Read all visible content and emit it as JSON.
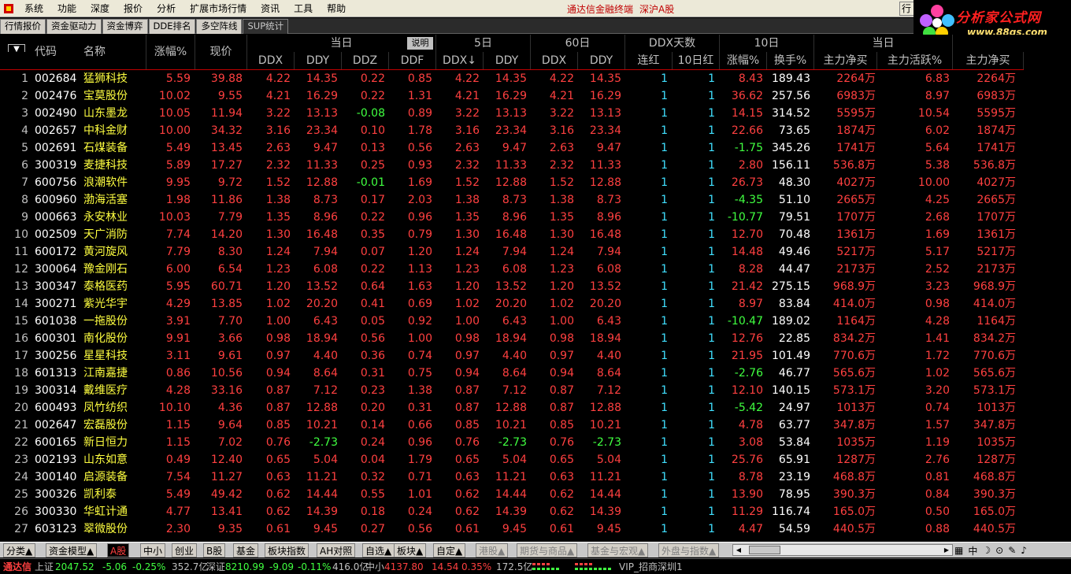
{
  "menu": {
    "items": [
      "系统",
      "功能",
      "深度",
      "报价",
      "分析",
      "扩展市场行情",
      "资讯",
      "工具",
      "帮助"
    ],
    "title_left": "通达信金融终端",
    "title_right": "深沪A股",
    "window_tab": "行"
  },
  "brand": {
    "title": "分析家公式网",
    "url": "www.88gs.com"
  },
  "tabs": [
    "行情报价",
    "资金驱动力",
    "资金博弈",
    "DDE排名",
    "多空阵线",
    "SUP统计"
  ],
  "header": {
    "top": {
      "today": "当日",
      "explain": "说明",
      "d5": "5日",
      "d60": "60日",
      "ddx_days": "DDX天数",
      "d10": "10日",
      "today2": "当日"
    },
    "cols": [
      "代码",
      "名称",
      "涨幅%",
      "现价",
      "DDX",
      "DDY",
      "DDZ",
      "DDF",
      "DDX↓",
      "DDY",
      "DDX",
      "DDY",
      "连红",
      "10日红",
      "涨幅%",
      "换手%",
      "主力净买",
      "主力活跃%",
      "主力净买"
    ]
  },
  "rows": [
    [
      "1",
      "002684",
      "猛狮科技",
      "5.59",
      "39.88",
      "4.22",
      "14.35",
      "0.22",
      "0.85",
      "4.22",
      "14.35",
      "4.22",
      "14.35",
      "1",
      "1",
      "8.43",
      "189.43",
      "2264万",
      "6.83",
      "2264万"
    ],
    [
      "2",
      "002476",
      "宝莫股份",
      "10.02",
      "9.55",
      "4.21",
      "16.29",
      "0.22",
      "1.31",
      "4.21",
      "16.29",
      "4.21",
      "16.29",
      "1",
      "1",
      "36.62",
      "257.56",
      "6983万",
      "8.97",
      "6983万"
    ],
    [
      "3",
      "002490",
      "山东墨龙",
      "10.05",
      "11.94",
      "3.22",
      "13.13",
      "-0.08",
      "0.89",
      "3.22",
      "13.13",
      "3.22",
      "13.13",
      "1",
      "1",
      "14.15",
      "314.52",
      "5595万",
      "10.54",
      "5595万"
    ],
    [
      "4",
      "002657",
      "中科金财",
      "10.00",
      "34.32",
      "3.16",
      "23.34",
      "0.10",
      "1.78",
      "3.16",
      "23.34",
      "3.16",
      "23.34",
      "1",
      "1",
      "22.66",
      "73.65",
      "1874万",
      "6.02",
      "1874万"
    ],
    [
      "5",
      "002691",
      "石煤装备",
      "5.49",
      "13.45",
      "2.63",
      "9.47",
      "0.13",
      "0.56",
      "2.63",
      "9.47",
      "2.63",
      "9.47",
      "1",
      "1",
      "-1.75",
      "345.26",
      "1741万",
      "5.64",
      "1741万"
    ],
    [
      "6",
      "300319",
      "麦捷科技",
      "5.89",
      "17.27",
      "2.32",
      "11.33",
      "0.25",
      "0.93",
      "2.32",
      "11.33",
      "2.32",
      "11.33",
      "1",
      "1",
      "2.80",
      "156.11",
      "536.8万",
      "5.38",
      "536.8万"
    ],
    [
      "7",
      "600756",
      "浪潮软件",
      "9.95",
      "9.72",
      "1.52",
      "12.88",
      "-0.01",
      "1.69",
      "1.52",
      "12.88",
      "1.52",
      "12.88",
      "1",
      "1",
      "26.73",
      "48.30",
      "4027万",
      "10.00",
      "4027万"
    ],
    [
      "8",
      "600960",
      "渤海活塞",
      "1.98",
      "11.86",
      "1.38",
      "8.73",
      "0.17",
      "2.03",
      "1.38",
      "8.73",
      "1.38",
      "8.73",
      "1",
      "1",
      "-4.35",
      "51.10",
      "2665万",
      "4.25",
      "2665万"
    ],
    [
      "9",
      "000663",
      "永安林业",
      "10.03",
      "7.79",
      "1.35",
      "8.96",
      "0.22",
      "0.96",
      "1.35",
      "8.96",
      "1.35",
      "8.96",
      "1",
      "1",
      "-10.77",
      "79.51",
      "1707万",
      "2.68",
      "1707万"
    ],
    [
      "10",
      "002509",
      "天广消防",
      "7.74",
      "14.20",
      "1.30",
      "16.48",
      "0.35",
      "0.79",
      "1.30",
      "16.48",
      "1.30",
      "16.48",
      "1",
      "1",
      "12.70",
      "70.48",
      "1361万",
      "1.69",
      "1361万"
    ],
    [
      "11",
      "600172",
      "黄河旋风",
      "7.79",
      "8.30",
      "1.24",
      "7.94",
      "0.07",
      "1.20",
      "1.24",
      "7.94",
      "1.24",
      "7.94",
      "1",
      "1",
      "14.48",
      "49.46",
      "5217万",
      "5.17",
      "5217万"
    ],
    [
      "12",
      "300064",
      "豫金刚石",
      "6.00",
      "6.54",
      "1.23",
      "6.08",
      "0.22",
      "1.13",
      "1.23",
      "6.08",
      "1.23",
      "6.08",
      "1",
      "1",
      "8.28",
      "44.47",
      "2173万",
      "2.52",
      "2173万"
    ],
    [
      "13",
      "300347",
      "泰格医药",
      "5.95",
      "60.71",
      "1.20",
      "13.52",
      "0.64",
      "1.63",
      "1.20",
      "13.52",
      "1.20",
      "13.52",
      "1",
      "1",
      "21.42",
      "275.15",
      "968.9万",
      "3.23",
      "968.9万"
    ],
    [
      "14",
      "300271",
      "紫光华宇",
      "4.29",
      "13.85",
      "1.02",
      "20.20",
      "0.41",
      "0.69",
      "1.02",
      "20.20",
      "1.02",
      "20.20",
      "1",
      "1",
      "8.97",
      "83.84",
      "414.0万",
      "0.98",
      "414.0万"
    ],
    [
      "15",
      "601038",
      "一拖股份",
      "3.91",
      "7.70",
      "1.00",
      "6.43",
      "0.05",
      "0.92",
      "1.00",
      "6.43",
      "1.00",
      "6.43",
      "1",
      "1",
      "-10.47",
      "189.02",
      "1164万",
      "4.28",
      "1164万"
    ],
    [
      "16",
      "600301",
      "南化股份",
      "9.91",
      "3.66",
      "0.98",
      "18.94",
      "0.56",
      "1.00",
      "0.98",
      "18.94",
      "0.98",
      "18.94",
      "1",
      "1",
      "12.76",
      "22.85",
      "834.2万",
      "1.41",
      "834.2万"
    ],
    [
      "17",
      "300256",
      "星星科技",
      "3.11",
      "9.61",
      "0.97",
      "4.40",
      "0.36",
      "0.74",
      "0.97",
      "4.40",
      "0.97",
      "4.40",
      "1",
      "1",
      "21.95",
      "101.49",
      "770.6万",
      "1.72",
      "770.6万"
    ],
    [
      "18",
      "601313",
      "江南嘉捷",
      "0.86",
      "10.56",
      "0.94",
      "8.64",
      "0.31",
      "0.75",
      "0.94",
      "8.64",
      "0.94",
      "8.64",
      "1",
      "1",
      "-2.76",
      "46.77",
      "565.6万",
      "1.02",
      "565.6万"
    ],
    [
      "19",
      "300314",
      "戴维医疗",
      "4.28",
      "33.16",
      "0.87",
      "7.12",
      "0.23",
      "1.38",
      "0.87",
      "7.12",
      "0.87",
      "7.12",
      "1",
      "1",
      "12.10",
      "140.15",
      "573.1万",
      "3.20",
      "573.1万"
    ],
    [
      "20",
      "600493",
      "凤竹纺织",
      "10.10",
      "4.36",
      "0.87",
      "12.88",
      "0.20",
      "0.31",
      "0.87",
      "12.88",
      "0.87",
      "12.88",
      "1",
      "1",
      "-5.42",
      "24.97",
      "1013万",
      "0.74",
      "1013万"
    ],
    [
      "21",
      "002647",
      "宏磊股份",
      "1.15",
      "9.64",
      "0.85",
      "10.21",
      "0.14",
      "0.66",
      "0.85",
      "10.21",
      "0.85",
      "10.21",
      "1",
      "1",
      "4.78",
      "63.77",
      "347.8万",
      "1.57",
      "347.8万"
    ],
    [
      "22",
      "600165",
      "新日恒力",
      "1.15",
      "7.02",
      "0.76",
      "-2.73",
      "0.24",
      "0.96",
      "0.76",
      "-2.73",
      "0.76",
      "-2.73",
      "1",
      "1",
      "3.08",
      "53.84",
      "1035万",
      "1.19",
      "1035万"
    ],
    [
      "23",
      "002193",
      "山东如意",
      "0.49",
      "12.40",
      "0.65",
      "5.04",
      "0.04",
      "1.79",
      "0.65",
      "5.04",
      "0.65",
      "5.04",
      "1",
      "1",
      "25.76",
      "65.91",
      "1287万",
      "2.76",
      "1287万"
    ],
    [
      "24",
      "300140",
      "启源装备",
      "7.54",
      "11.27",
      "0.63",
      "11.21",
      "0.32",
      "0.71",
      "0.63",
      "11.21",
      "0.63",
      "11.21",
      "1",
      "1",
      "8.78",
      "23.19",
      "468.8万",
      "0.81",
      "468.8万"
    ],
    [
      "25",
      "300326",
      "凯利泰",
      "5.49",
      "49.42",
      "0.62",
      "14.44",
      "0.55",
      "1.01",
      "0.62",
      "14.44",
      "0.62",
      "14.44",
      "1",
      "1",
      "13.90",
      "78.95",
      "390.3万",
      "0.84",
      "390.3万"
    ],
    [
      "26",
      "300330",
      "华虹计通",
      "4.77",
      "13.41",
      "0.62",
      "14.39",
      "0.18",
      "0.24",
      "0.62",
      "14.39",
      "0.62",
      "14.39",
      "1",
      "1",
      "11.29",
      "116.74",
      "165.0万",
      "0.50",
      "165.0万"
    ],
    [
      "27",
      "603123",
      "翠微股份",
      "2.30",
      "9.35",
      "0.61",
      "9.45",
      "0.27",
      "0.56",
      "0.61",
      "9.45",
      "0.61",
      "9.45",
      "1",
      "1",
      "4.47",
      "54.59",
      "440.5万",
      "0.88",
      "440.5万"
    ]
  ],
  "bottom_tabs": [
    "分类▲",
    "资金模型▲",
    "A股",
    "中小",
    "创业",
    "B股",
    "基金",
    "板块指数",
    "AH对照",
    "自选▲",
    "板块▲",
    "自定▲",
    "港股▲",
    "期货与商品▲",
    "基金与宏观▲",
    "外盘与指数▲"
  ],
  "tray": [
    "中",
    "☽",
    "⊙",
    "✎",
    "♪"
  ],
  "status": {
    "app": "通达信",
    "sh_label": "上证",
    "sh_val": "2047.52",
    "sh_chg": "-5.06",
    "sh_pct": "-0.25%",
    "sh_amt": "352.7亿",
    "sz_label": "深证",
    "sz_val": "8210.99",
    "sz_chg": "-9.09",
    "sz_pct": "-0.11%",
    "sz_amt": "416.0亿",
    "zx_label": "中小",
    "zx_val": "4137.80",
    "zx_chg": "14.54",
    "zx_pct": "0.35%",
    "zx_amt": "172.5亿",
    "vip": "VIP_招商深圳1"
  },
  "colors": {
    "up": "#ff4040",
    "down": "#40ff40",
    "name": "#ffff40",
    "count": "#40e0ff"
  }
}
